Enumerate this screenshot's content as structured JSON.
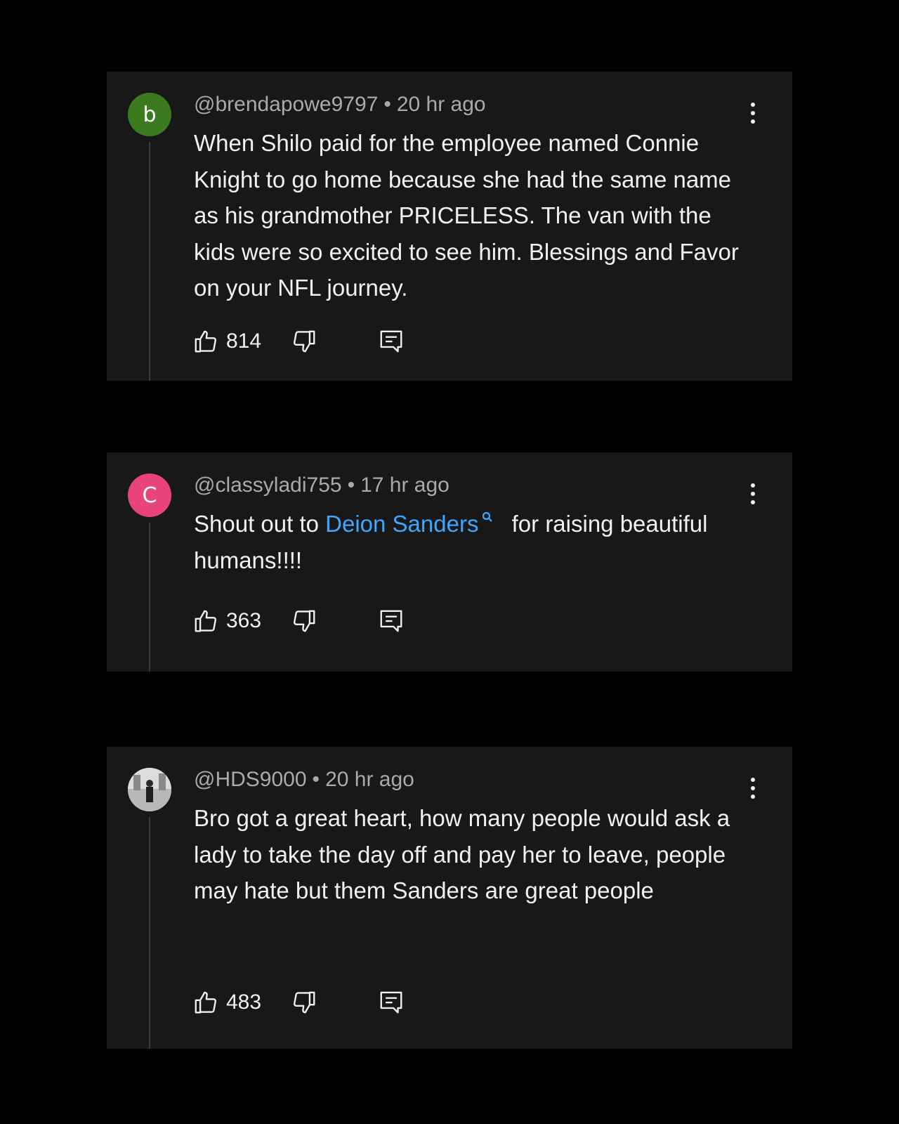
{
  "comments": [
    {
      "avatar_letter": "b",
      "avatar_color": "#3b7a1f",
      "handle": "@brendapowe9797",
      "separator": "•",
      "time": "20 hr ago",
      "text": "When Shilo paid for the employee named Connie Knight to go home because she had the same name as his grandmother PRICELESS. The van with the kids were so excited to see him. Blessings and Favor on your NFL journey.",
      "likes": "814"
    },
    {
      "avatar_letter": "C",
      "avatar_color": "#e8437a",
      "handle": "@classyladi755",
      "separator": "•",
      "time": "17 hr ago",
      "text_before": "Shout out to",
      "mention": "Deion Sanders",
      "mention_icon": "search-icon",
      "text_after": "for raising beautiful humans!!!!",
      "likes": "363"
    },
    {
      "avatar_letter": "",
      "avatar_color": "#cfcfcf",
      "handle": "@HDS9000",
      "separator": "•",
      "time": "20 hr ago",
      "text": "Bro got a great heart, how many people would ask a lady to take the day off and pay her to leave, people may hate but them Sanders are great people",
      "likes": "483"
    }
  ],
  "colors": {
    "background": "#000000",
    "card": "#181818",
    "text": "#f1f1f1",
    "secondary_text": "#aaaaaa",
    "link": "#3ea6ff"
  },
  "icons": [
    "like-icon",
    "dislike-icon",
    "reply-icon",
    "more-options-icon"
  ]
}
